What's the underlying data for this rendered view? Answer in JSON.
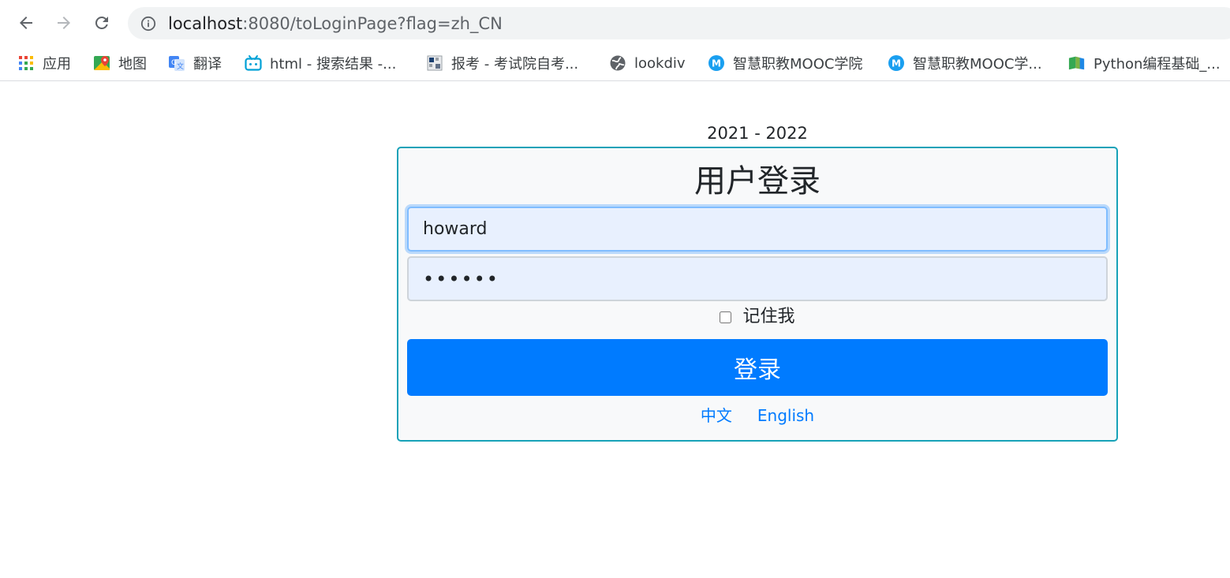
{
  "browser": {
    "url_host": "localhost",
    "url_rest": ":8080/toLoginPage?flag=zh_CN",
    "bookmarks": [
      {
        "label": "应用",
        "icon": "apps-grid-icon"
      },
      {
        "label": "地图",
        "icon": "maps-icon"
      },
      {
        "label": "翻译",
        "icon": "translate-icon"
      },
      {
        "label": "html - 搜索结果 -...",
        "icon": "bilibili-icon"
      },
      {
        "label": "报考 - 考试院自考...",
        "icon": "page-icon"
      },
      {
        "label": "lookdiv",
        "icon": "globe-icon"
      },
      {
        "label": "智慧职教MOOC学院",
        "icon": "mooc-icon"
      },
      {
        "label": "智慧职教MOOC学...",
        "icon": "mooc-icon"
      },
      {
        "label": "Python编程基础_...",
        "icon": "book-icon"
      }
    ]
  },
  "page": {
    "year_range": "2021 - 2022",
    "title": "用户登录",
    "username_value": "howard",
    "password_value": "••••••",
    "remember_label": "记住我",
    "login_button": "登录",
    "lang_zh": "中文",
    "lang_en": "English"
  },
  "colors": {
    "primary": "#007bff",
    "card_border": "#17a2b8",
    "card_bg": "#f8f9fa",
    "input_autofill_bg": "#e8f0fe"
  }
}
